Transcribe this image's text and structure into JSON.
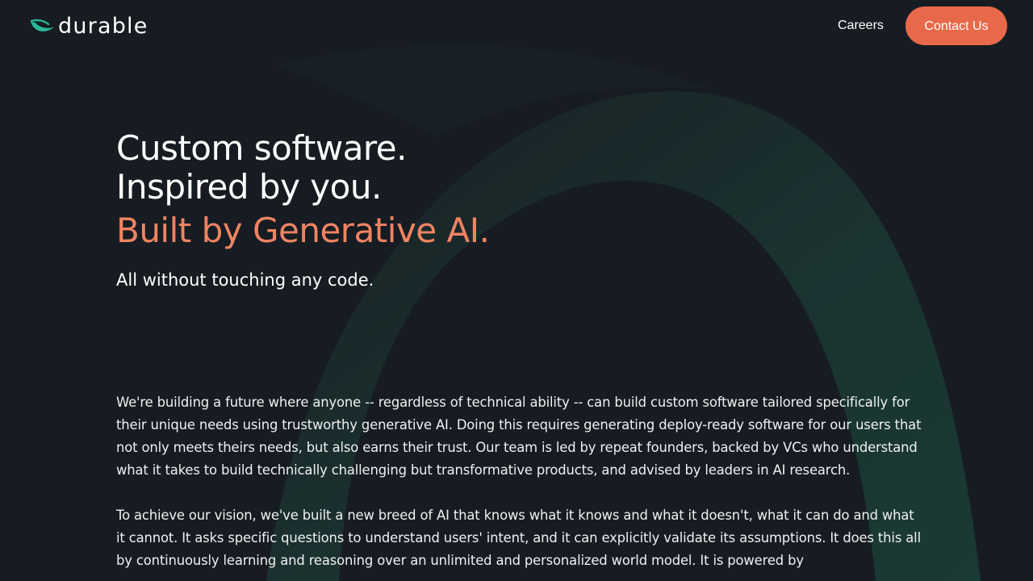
{
  "brand": {
    "name": "durable",
    "accent_color": "#e8694a",
    "highlight_color": "#ef8462",
    "logo_mark_color": "#2bb89a",
    "background_color": "#171c22"
  },
  "nav": {
    "careers_label": "Careers",
    "contact_label": "Contact Us"
  },
  "hero": {
    "line1": "Custom software.",
    "line2": "Inspired by you.",
    "line3": "Built by Generative AI.",
    "subtitle": "All without touching any code."
  },
  "body": {
    "paragraph1": "We're building a future where anyone -- regardless of technical ability -- can build custom software tailored specifically for their unique needs using trustworthy generative AI. Doing this requires generating deploy-ready software for our users that not only meets theirs needs, but also earns their trust. Our team is led by repeat founders, backed by VCs who understand what it takes to build technically challenging but transformative products, and advised by leaders in AI research.",
    "paragraph2": "To achieve our vision, we've built a new breed of AI that knows what it knows and what it doesn't, what it can do and what it cannot. It asks specific questions to understand users' intent, and it can explicitly validate its assumptions. It does this all by continuously learning and reasoning over an unlimited and personalized world model. It is powered by"
  },
  "icons": {
    "logo": "durable-leaf-logo-icon"
  }
}
